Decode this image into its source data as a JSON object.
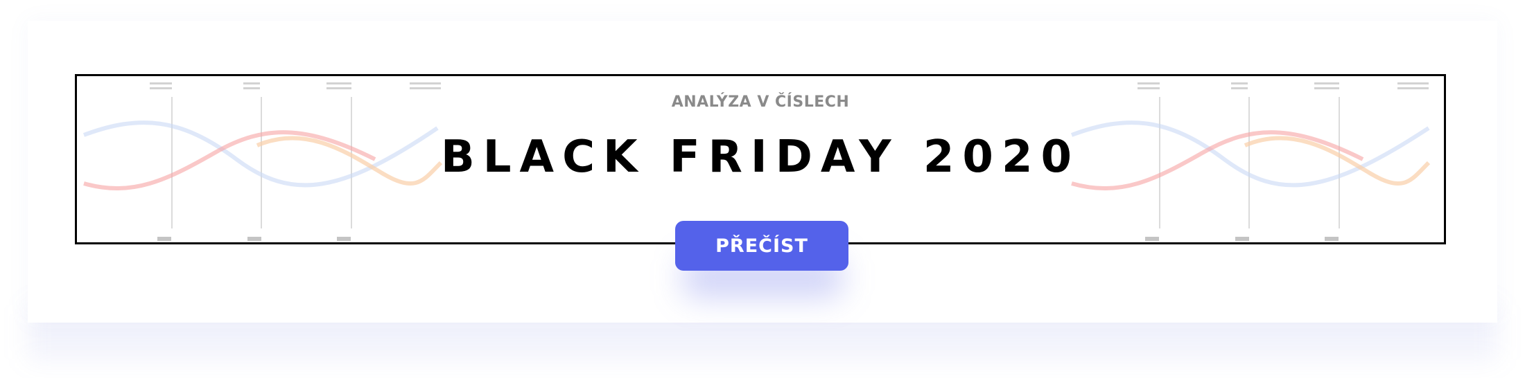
{
  "banner": {
    "subtitle": "ANALÝZA V ČÍSLECH",
    "title": "BLACK FRIDAY 2020",
    "cta_label": "PŘEČÍST"
  },
  "colors": {
    "accent": "#5462ea",
    "title": "#000000",
    "subtitle": "#8a8a8a",
    "wave_red": "#f7a3a3",
    "wave_blue": "#c9d8f5",
    "wave_orange": "#f9cfa8"
  },
  "decorations": {
    "left": "wave-timeline-graphic",
    "right": "wave-timeline-graphic"
  }
}
